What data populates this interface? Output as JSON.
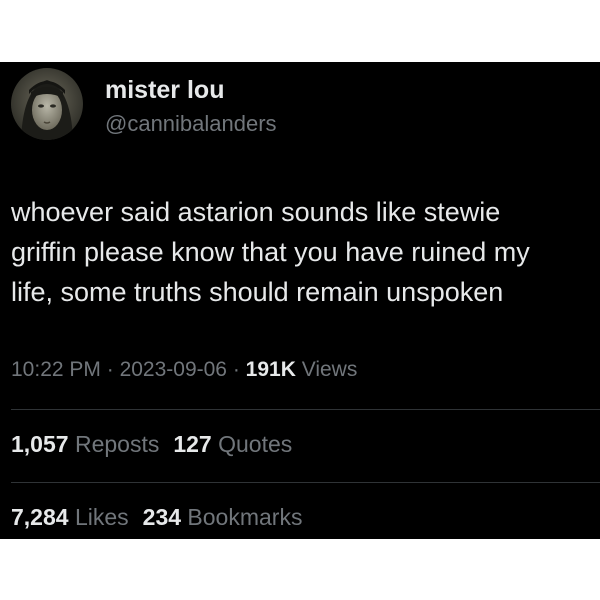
{
  "author": {
    "display_name": "mister lou",
    "handle": "@cannibalanders",
    "avatar_icon": "user-avatar-icon"
  },
  "post": {
    "text": "whoever said astarion sounds like stewie\ngriffin please know that you have ruined my\nlife, some truths should remain unspoken"
  },
  "meta": {
    "time": "10:22 PM",
    "separator": " · ",
    "date": "2023-09-06",
    "views_count": "191K",
    "views_label": "Views"
  },
  "stats": {
    "reposts_count": "1,057",
    "reposts_label": "Reposts",
    "quotes_count": "127",
    "quotes_label": "Quotes",
    "likes_count": "7,284",
    "likes_label": "Likes",
    "bookmarks_count": "234",
    "bookmarks_label": "Bookmarks"
  },
  "colors": {
    "background": "#000000",
    "primary_text": "#e7e9ea",
    "secondary_text": "#71767b",
    "divider": "#2f3336"
  }
}
